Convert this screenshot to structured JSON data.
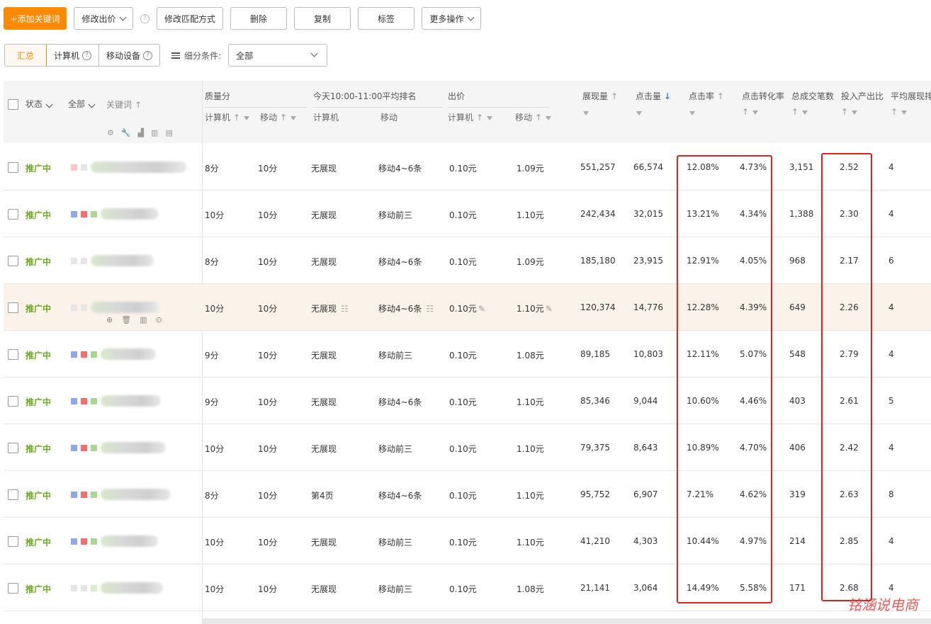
{
  "toolbar": {
    "add_keyword": "+添加关键词",
    "modify_bid": "修改出价",
    "modify_match": "修改匹配方式",
    "delete": "删除",
    "copy": "复制",
    "tag": "标签",
    "more_ops": "更多操作"
  },
  "device_tabs": [
    "汇总",
    "计算机",
    "移动设备"
  ],
  "filter": {
    "label": "细分条件:",
    "selected": "全部"
  },
  "header": {
    "status": "状态",
    "all": "全部",
    "keyword": "关键词",
    "quality": "质量分",
    "quality_pc": "计算机",
    "quality_mobile": "移动",
    "rank_title": "今天10:00-11:00平均排名",
    "rank_pc": "计算机",
    "rank_mobile": "移动",
    "bid": "出价",
    "bid_pc": "计算机",
    "bid_mobile": "移动",
    "impressions": "展现量",
    "clicks": "点击量",
    "ctr": "点击率",
    "cvr": "点击转化率",
    "orders": "总成交笔数",
    "roi": "投入产出比",
    "avg_rank": "平均展现排名"
  },
  "rows": [
    {
      "status": "推广中",
      "q_pc": "8分",
      "q_m": "10分",
      "r_pc": "无展现",
      "r_m": "移动4~6条",
      "b_pc": "0.10元",
      "b_m": "1.09元",
      "imp": "551,257",
      "clk": "66,574",
      "ctr": "12.08%",
      "cvr": "4.73%",
      "orders": "3,151",
      "roi": "2.52",
      "rank": "4"
    },
    {
      "status": "推广中",
      "q_pc": "10分",
      "q_m": "10分",
      "r_pc": "无展现",
      "r_m": "移动前三",
      "b_pc": "0.10元",
      "b_m": "1.10元",
      "imp": "242,434",
      "clk": "32,015",
      "ctr": "13.21%",
      "cvr": "4.34%",
      "orders": "1,388",
      "roi": "2.30",
      "rank": "4"
    },
    {
      "status": "推广中",
      "q_pc": "8分",
      "q_m": "10分",
      "r_pc": "无展现",
      "r_m": "移动4~6条",
      "b_pc": "0.10元",
      "b_m": "1.09元",
      "imp": "185,180",
      "clk": "23,915",
      "ctr": "12.91%",
      "cvr": "4.05%",
      "orders": "968",
      "roi": "2.17",
      "rank": "6"
    },
    {
      "status": "推广中",
      "q_pc": "10分",
      "q_m": "10分",
      "r_pc": "无展现",
      "r_m": "移动4~6条",
      "b_pc": "0.10元",
      "b_m": "1.10元",
      "imp": "120,374",
      "clk": "14,776",
      "ctr": "12.28%",
      "cvr": "4.39%",
      "orders": "649",
      "roi": "2.26",
      "rank": "4"
    },
    {
      "status": "推广中",
      "q_pc": "9分",
      "q_m": "10分",
      "r_pc": "无展现",
      "r_m": "移动前三",
      "b_pc": "0.10元",
      "b_m": "1.08元",
      "imp": "89,185",
      "clk": "10,803",
      "ctr": "12.11%",
      "cvr": "5.07%",
      "orders": "548",
      "roi": "2.79",
      "rank": "4"
    },
    {
      "status": "推广中",
      "q_pc": "9分",
      "q_m": "10分",
      "r_pc": "无展现",
      "r_m": "移动4~6条",
      "b_pc": "0.10元",
      "b_m": "1.10元",
      "imp": "85,346",
      "clk": "9,044",
      "ctr": "10.60%",
      "cvr": "4.46%",
      "orders": "403",
      "roi": "2.61",
      "rank": "5"
    },
    {
      "status": "推广中",
      "q_pc": "10分",
      "q_m": "10分",
      "r_pc": "无展现",
      "r_m": "移动前三",
      "b_pc": "0.10元",
      "b_m": "1.10元",
      "imp": "79,375",
      "clk": "8,643",
      "ctr": "10.89%",
      "cvr": "4.70%",
      "orders": "406",
      "roi": "2.42",
      "rank": "4"
    },
    {
      "status": "推广中",
      "q_pc": "8分",
      "q_m": "10分",
      "r_pc": "第4页",
      "r_m": "移动4~6条",
      "b_pc": "0.10元",
      "b_m": "1.10元",
      "imp": "95,752",
      "clk": "6,907",
      "ctr": "7.21%",
      "cvr": "4.62%",
      "orders": "319",
      "roi": "2.63",
      "rank": "8"
    },
    {
      "status": "推广中",
      "q_pc": "10分",
      "q_m": "10分",
      "r_pc": "无展现",
      "r_m": "移动前三",
      "b_pc": "0.10元",
      "b_m": "1.10元",
      "imp": "41,210",
      "clk": "4,303",
      "ctr": "10.44%",
      "cvr": "4.97%",
      "orders": "214",
      "roi": "2.85",
      "rank": "4"
    },
    {
      "status": "推广中",
      "q_pc": "10分",
      "q_m": "10分",
      "r_pc": "无展现",
      "r_m": "移动前三",
      "b_pc": "0.10元",
      "b_m": "1.08元",
      "imp": "21,141",
      "clk": "3,064",
      "ctr": "14.49%",
      "cvr": "5.58%",
      "orders": "171",
      "roi": "2.68",
      "rank": "4"
    }
  ],
  "watermark": "铭涵说电商",
  "colors": {
    "primary": "#ff8a00",
    "status_green": "#6aa820",
    "highlight_box": "#e02020",
    "sort_active": "#3a7be0"
  }
}
